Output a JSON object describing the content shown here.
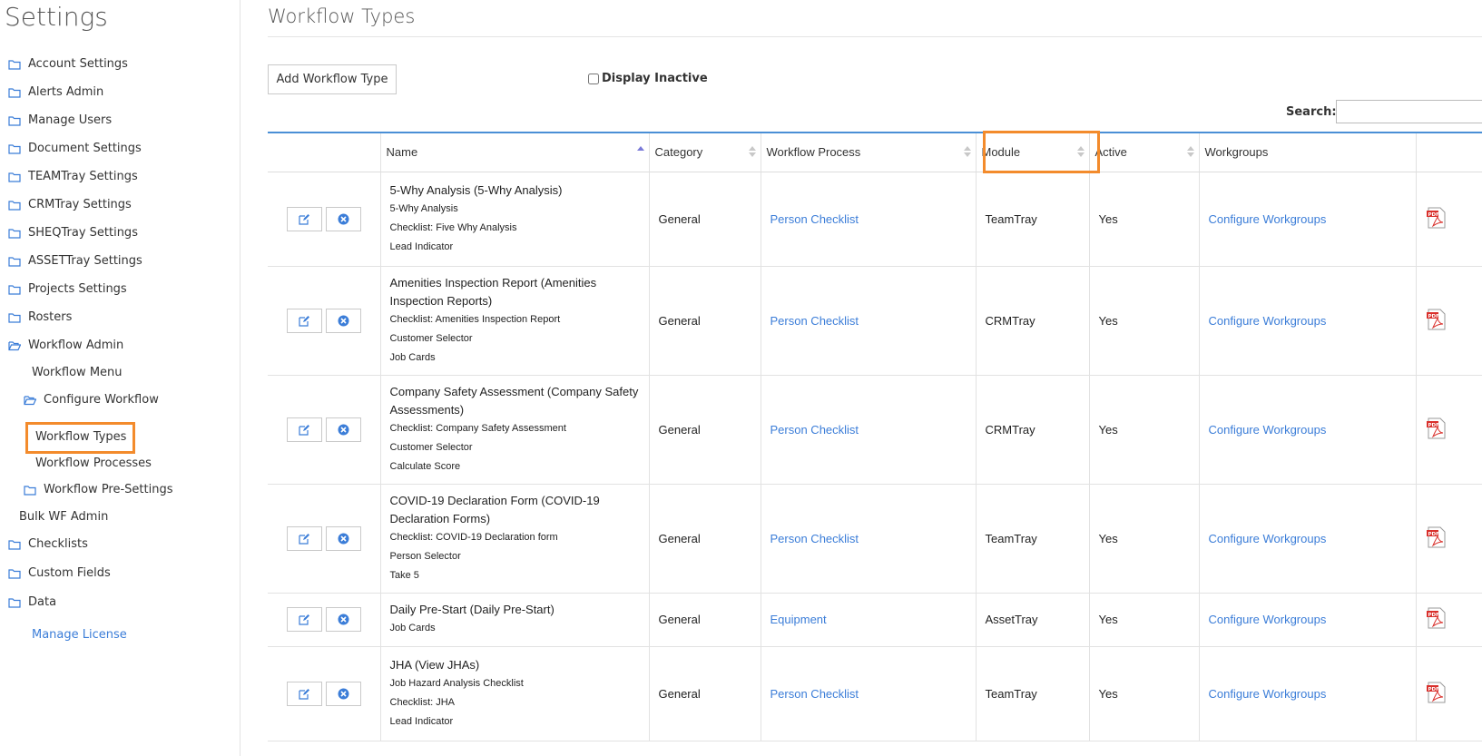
{
  "sidebar": {
    "title": "Settings",
    "items": [
      {
        "label": "Account Settings"
      },
      {
        "label": "Alerts Admin"
      },
      {
        "label": "Manage Users"
      },
      {
        "label": "Document Settings"
      },
      {
        "label": "TEAMTray Settings"
      },
      {
        "label": "CRMTray Settings"
      },
      {
        "label": "SHEQTray Settings"
      },
      {
        "label": "ASSETTray Settings"
      },
      {
        "label": "Projects Settings"
      },
      {
        "label": "Rosters"
      },
      {
        "label": "Workflow Admin"
      },
      {
        "label": "Workflow Menu"
      },
      {
        "label": "Configure Workflow"
      },
      {
        "label": "Workflow Types"
      },
      {
        "label": "Workflow Processes"
      },
      {
        "label": "Workflow Pre-Settings"
      },
      {
        "label": "Bulk WF Admin"
      },
      {
        "label": "Checklists"
      },
      {
        "label": "Custom Fields"
      },
      {
        "label": "Data"
      },
      {
        "label": "Manage License"
      }
    ]
  },
  "main": {
    "title": "Workflow Types",
    "add_button": "Add Workflow Type",
    "display_inactive_label": "Display Inactive",
    "search_label": "Search:",
    "search_value": ""
  },
  "table": {
    "columns": [
      "Name",
      "Category",
      "Workflow Process",
      "Module",
      "Active",
      "Workgroups"
    ],
    "rows": [
      {
        "name": "5-Why Analysis (5-Why Analysis)",
        "details": [
          "5-Why Analysis",
          "Checklist: Five Why Analysis",
          "Lead Indicator"
        ],
        "category": "General",
        "process": "Person Checklist",
        "module": "TeamTray",
        "active": "Yes",
        "workgroups": "Configure Workgroups"
      },
      {
        "name": "Amenities Inspection Report (Amenities Inspection Reports)",
        "details": [
          "Checklist: Amenities Inspection Report",
          "Customer Selector",
          "Job Cards"
        ],
        "category": "General",
        "process": "Person Checklist",
        "module": "CRMTray",
        "active": "Yes",
        "workgroups": "Configure Workgroups"
      },
      {
        "name": "Company Safety Assessment (Company Safety Assessments)",
        "details": [
          "Checklist: Company Safety Assessment",
          "Customer Selector",
          "Calculate Score"
        ],
        "category": "General",
        "process": "Person Checklist",
        "module": "CRMTray",
        "active": "Yes",
        "workgroups": "Configure Workgroups"
      },
      {
        "name": "COVID-19 Declaration Form (COVID-19 Declaration Forms)",
        "details": [
          "Checklist: COVID-19 Declaration form",
          "Person Selector",
          "Take 5"
        ],
        "category": "General",
        "process": "Person Checklist",
        "module": "TeamTray",
        "active": "Yes",
        "workgroups": "Configure Workgroups"
      },
      {
        "name": "Daily Pre-Start (Daily Pre-Start)",
        "details": [
          "Job Cards"
        ],
        "category": "General",
        "process": "Equipment",
        "module": "AssetTray",
        "active": "Yes",
        "workgroups": "Configure Workgroups"
      },
      {
        "name": "JHA (View JHAs)",
        "details": [
          "Job Hazard Analysis Checklist",
          "Checklist: JHA",
          "Lead Indicator"
        ],
        "category": "General",
        "process": "Person Checklist",
        "module": "TeamTray",
        "active": "Yes",
        "workgroups": "Configure Workgroups"
      }
    ]
  },
  "colors": {
    "accent": "#3b7dd8",
    "highlight": "#f38b2c",
    "header_rule": "#4a8fd6",
    "pdf_red": "#d9302c"
  }
}
